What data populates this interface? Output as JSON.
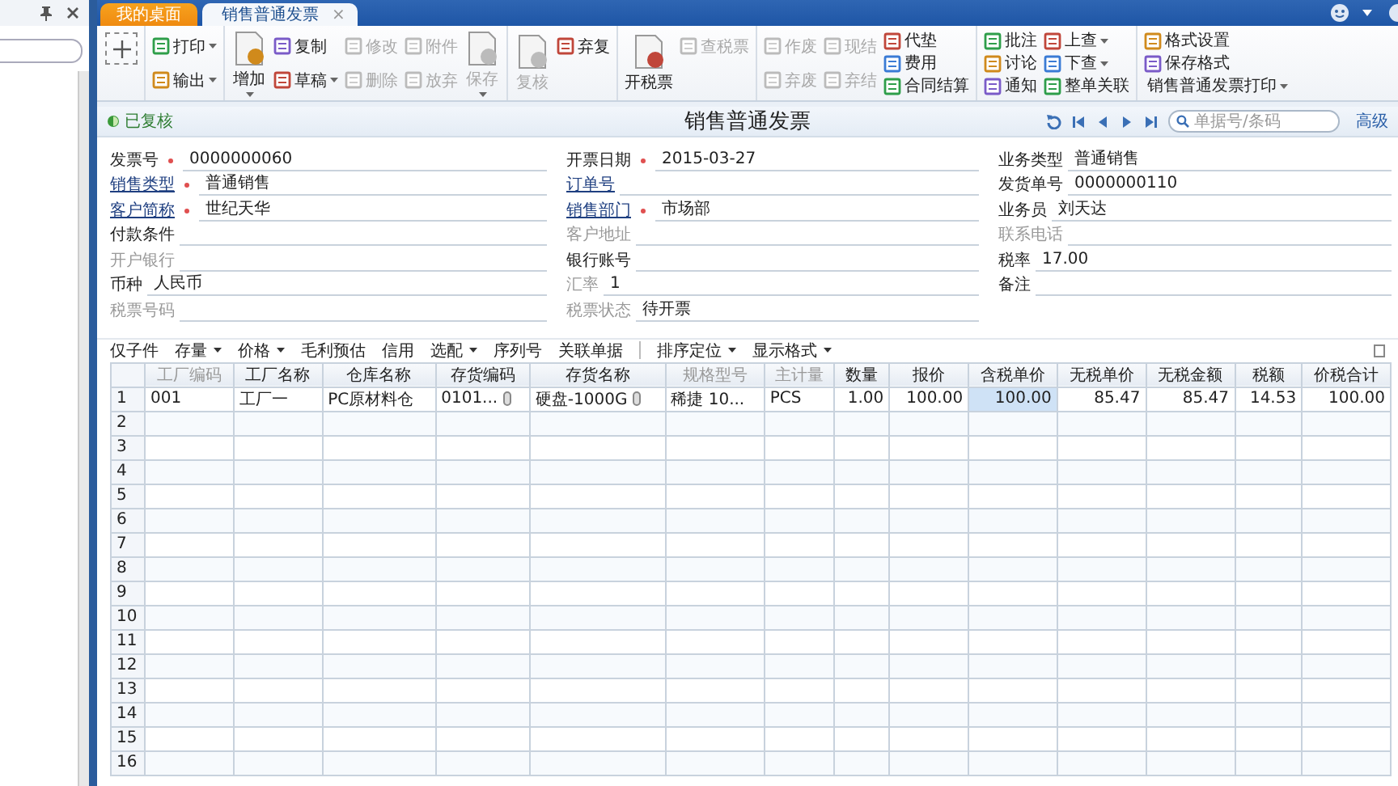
{
  "tabs": [
    {
      "label": "我的桌面",
      "selected": false
    },
    {
      "label": "销售普通发票",
      "selected": true,
      "close": "×"
    }
  ],
  "toolbar": [
    [
      {
        "kind": "plus"
      }
    ],
    [
      {
        "kind": "small",
        "label": "打印",
        "disabled": false,
        "dropdown": true
      },
      {
        "kind": "small",
        "label": "输出",
        "disabled": false,
        "dropdown": true
      }
    ],
    [
      {
        "kind": "large",
        "label": "增加",
        "disabled": false,
        "dropdown": true
      },
      {
        "kind": "small",
        "label": "复制",
        "disabled": false,
        "dropdown": false
      },
      {
        "kind": "small",
        "label": "草稿",
        "disabled": false,
        "dropdown": true
      },
      {
        "kind": "small",
        "label": "修改",
        "disabled": true,
        "dropdown": false
      },
      {
        "kind": "small",
        "label": "删除",
        "disabled": true,
        "dropdown": false
      },
      {
        "kind": "small",
        "label": "附件",
        "disabled": true,
        "dropdown": false
      },
      {
        "kind": "small",
        "label": "放弃",
        "disabled": true,
        "dropdown": false
      },
      {
        "kind": "large",
        "label": "保存",
        "disabled": true,
        "dropdown": true
      }
    ],
    [
      {
        "kind": "large",
        "label": "复核",
        "disabled": true,
        "dropdown": false
      },
      {
        "kind": "small",
        "label": "弃复",
        "disabled": false,
        "dropdown": false
      }
    ],
    [
      {
        "kind": "large",
        "label": "开税票",
        "disabled": false,
        "dropdown": false
      },
      {
        "kind": "small",
        "label": "查税票",
        "disabled": true,
        "dropdown": false
      }
    ],
    [
      {
        "kind": "small",
        "label": "作废",
        "disabled": true,
        "dropdown": false
      },
      {
        "kind": "small",
        "label": "弃废",
        "disabled": true,
        "dropdown": false
      },
      {
        "kind": "small",
        "label": "现结",
        "disabled": true,
        "dropdown": false
      },
      {
        "kind": "small",
        "label": "弃结",
        "disabled": true,
        "dropdown": false
      },
      {
        "kind": "mini",
        "label": "代垫",
        "disabled": false,
        "dropdown": false
      },
      {
        "kind": "mini",
        "label": "费用",
        "disabled": false,
        "dropdown": false
      },
      {
        "kind": "mini",
        "label": "合同结算",
        "disabled": false,
        "dropdown": false
      }
    ],
    [
      {
        "kind": "mini",
        "label": "批注",
        "disabled": false,
        "dropdown": false
      },
      {
        "kind": "mini",
        "label": "讨论",
        "disabled": false,
        "dropdown": false
      },
      {
        "kind": "mini",
        "label": "通知",
        "disabled": false,
        "dropdown": false
      },
      {
        "kind": "mini",
        "label": "上查",
        "disabled": false,
        "dropdown": true
      },
      {
        "kind": "mini",
        "label": "下查",
        "disabled": false,
        "dropdown": true
      },
      {
        "kind": "mini",
        "label": "整单关联",
        "disabled": false,
        "dropdown": false
      }
    ],
    [
      {
        "kind": "mini",
        "label": "格式设置",
        "disabled": false,
        "dropdown": false
      },
      {
        "kind": "mini",
        "label": "保存格式",
        "disabled": false,
        "dropdown": false
      },
      {
        "kind": "text",
        "label": "销售普通发票打印",
        "disabled": false,
        "dropdown": true
      }
    ]
  ],
  "form": {
    "status": "已复核",
    "title": "销售普通发票",
    "search": {
      "placeholder": "单据号/条码"
    },
    "advanced": "高级",
    "columns": [
      [
        {
          "label": "发票号",
          "value": "0000000060",
          "required": true,
          "link": false,
          "muted": false
        },
        {
          "label": "销售类型",
          "value": "普通销售",
          "required": true,
          "link": true,
          "muted": false
        },
        {
          "label": "客户简称",
          "value": "世纪天华",
          "required": true,
          "link": true,
          "muted": false
        },
        {
          "label": "付款条件",
          "required": false,
          "link": false,
          "muted": false
        },
        {
          "label": "开户银行",
          "required": false,
          "link": false,
          "muted": true
        },
        {
          "label": "币种",
          "value": "人民币",
          "required": false,
          "link": false,
          "muted": false
        },
        {
          "label": "税票号码",
          "required": false,
          "link": false,
          "muted": true
        }
      ],
      [
        {
          "label": "开票日期",
          "value": "2015-03-27",
          "required": true,
          "link": false,
          "muted": false
        },
        {
          "label": "订单号",
          "required": false,
          "link": true,
          "muted": false
        },
        {
          "label": "销售部门",
          "value": "市场部",
          "required": true,
          "link": true,
          "muted": false
        },
        {
          "label": "客户地址",
          "required": false,
          "link": false,
          "muted": true
        },
        {
          "label": "银行账号",
          "required": false,
          "link": false,
          "muted": false
        },
        {
          "label": "汇率",
          "value": "1",
          "required": false,
          "link": false,
          "muted": true
        },
        {
          "label": "税票状态",
          "value": "待开票",
          "required": false,
          "link": false,
          "muted": true
        }
      ],
      [
        {
          "label": "业务类型",
          "value": "普通销售",
          "required": false,
          "link": false,
          "muted": false
        },
        {
          "label": "发货单号",
          "value": "0000000110",
          "required": false,
          "link": false,
          "muted": false
        },
        {
          "label": "业务员",
          "value": "刘天达",
          "required": false,
          "link": false,
          "muted": false
        },
        {
          "label": "联系电话",
          "required": false,
          "link": false,
          "muted": true
        },
        {
          "label": "税率",
          "value": "17.00",
          "required": false,
          "link": false,
          "muted": false
        },
        {
          "label": "备注",
          "required": false,
          "link": false,
          "muted": false
        }
      ]
    ]
  },
  "grid_tools": [
    [
      {
        "label": "仅子件",
        "dropdown": false
      },
      {
        "label": "存量",
        "dropdown": true
      },
      {
        "label": "价格",
        "dropdown": true
      },
      {
        "label": "毛利预估",
        "dropdown": false
      },
      {
        "label": "信用",
        "dropdown": false
      },
      {
        "label": "选配",
        "dropdown": true
      },
      {
        "label": "序列号",
        "dropdown": false
      },
      {
        "label": "关联单据",
        "dropdown": false
      }
    ],
    [
      {
        "label": "排序定位",
        "dropdown": true
      },
      {
        "label": "显示格式",
        "dropdown": true
      }
    ]
  ],
  "table": {
    "columns": [
      {
        "label": "工厂编码",
        "muted": true,
        "numeric": false
      },
      {
        "label": "工厂名称",
        "muted": false,
        "numeric": false
      },
      {
        "label": "仓库名称",
        "muted": false,
        "numeric": false
      },
      {
        "label": "存货编码",
        "muted": false,
        "numeric": false
      },
      {
        "label": "存货名称",
        "muted": false,
        "numeric": false
      },
      {
        "label": "规格型号",
        "muted": true,
        "numeric": false
      },
      {
        "label": "主计量",
        "muted": true,
        "numeric": false
      },
      {
        "label": "数量",
        "muted": false,
        "numeric": true
      },
      {
        "label": "报价",
        "muted": false,
        "numeric": true
      },
      {
        "label": "含税单价",
        "muted": false,
        "numeric": true
      },
      {
        "label": "无税单价",
        "muted": false,
        "numeric": true
      },
      {
        "label": "无税金额",
        "muted": false,
        "numeric": true
      },
      {
        "label": "税额",
        "muted": false,
        "numeric": true
      },
      {
        "label": "价税合计",
        "muted": false,
        "numeric": true
      }
    ],
    "rows": [
      {
        "number": "1",
        "cells": [
          {
            "text": "001",
            "selected": false,
            "lookup": false
          },
          {
            "text": "工厂一",
            "selected": false,
            "lookup": false
          },
          {
            "text": "PC原材料仓",
            "selected": false,
            "lookup": false
          },
          {
            "text": "0101...",
            "selected": false,
            "lookup": true
          },
          {
            "text": "硬盘-1000G",
            "selected": false,
            "lookup": true
          },
          {
            "text": "稀捷 10...",
            "selected": false,
            "lookup": false
          },
          {
            "text": "PCS",
            "selected": false,
            "lookup": false
          },
          {
            "text": "1.00",
            "selected": false,
            "lookup": false
          },
          {
            "text": "100.00",
            "selected": false,
            "lookup": false
          },
          {
            "text": "100.00",
            "selected": true,
            "lookup": false
          },
          {
            "text": "85.47",
            "selected": false,
            "lookup": false
          },
          {
            "text": "85.47",
            "selected": false,
            "lookup": false
          },
          {
            "text": "14.53",
            "selected": false,
            "lookup": false
          },
          {
            "text": "100.00",
            "selected": false,
            "lookup": false
          }
        ]
      },
      {
        "number": "2"
      },
      {
        "number": "3"
      },
      {
        "number": "4"
      },
      {
        "number": "5"
      },
      {
        "number": "6"
      },
      {
        "number": "7"
      },
      {
        "number": "8"
      },
      {
        "number": "9"
      },
      {
        "number": "10"
      },
      {
        "number": "11"
      },
      {
        "number": "12"
      },
      {
        "number": "13"
      },
      {
        "number": "14"
      },
      {
        "number": "15"
      },
      {
        "number": "16"
      }
    ]
  }
}
